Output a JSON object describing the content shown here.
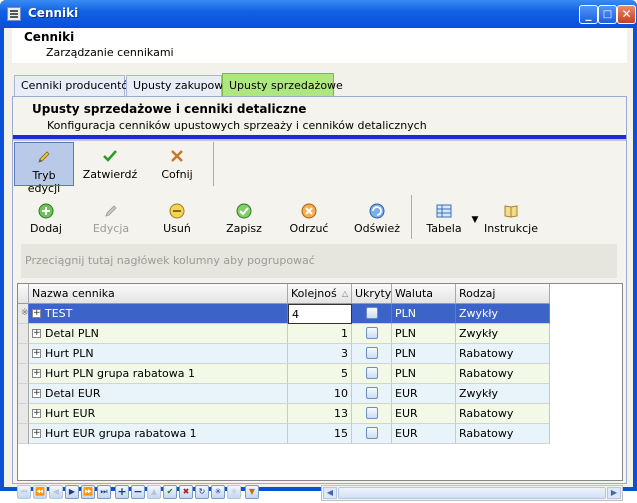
{
  "window": {
    "title": "Cenniki"
  },
  "header": {
    "title": "Cenniki",
    "subtitle": "Zarządzanie cennikami"
  },
  "tabs": [
    {
      "label": "Cenniki producentów"
    },
    {
      "label": "Upusty zakupowe"
    },
    {
      "label": "Upusty sprzedażowe"
    }
  ],
  "section": {
    "title": "Upusty sprzedażowe i cenniki detaliczne",
    "description": "Konfiguracja cenników upustowych sprzeaży i cenników detalicznych"
  },
  "toolbar1": {
    "edit_mode": "Tryb edycji",
    "confirm": "Zatwierdź",
    "undo": "Cofnij"
  },
  "toolbar2": {
    "add": "Dodaj",
    "edit": "Edycja",
    "delete": "Usuń",
    "save": "Zapisz",
    "discard": "Odrzuć",
    "refresh": "Odśwież",
    "table": "Tabela",
    "instructions": "Instrukcje"
  },
  "grid": {
    "group_hint": "Przeciągnij tutaj nagłówek kolumny aby pogrupować",
    "columns": [
      "Nazwa cennika",
      "Kolejnoś",
      "Ukryty",
      "Waluta",
      "Rodzaj"
    ],
    "rows": [
      {
        "name": "TEST",
        "order": "4",
        "currency": "PLN",
        "type": "Zwykły"
      },
      {
        "name": "Detal PLN",
        "order": "1",
        "currency": "PLN",
        "type": "Zwykły"
      },
      {
        "name": "Hurt PLN",
        "order": "3",
        "currency": "PLN",
        "type": "Rabatowy"
      },
      {
        "name": "Hurt PLN grupa rabatowa 1",
        "order": "5",
        "currency": "PLN",
        "type": "Rabatowy"
      },
      {
        "name": "Detal EUR",
        "order": "10",
        "currency": "EUR",
        "type": "Zwykły"
      },
      {
        "name": "Hurt EUR",
        "order": "13",
        "currency": "EUR",
        "type": "Rabatowy"
      },
      {
        "name": "Hurt EUR grupa rabatowa 1",
        "order": "15",
        "currency": "EUR",
        "type": "Rabatowy"
      }
    ],
    "new_row_marker": "※"
  },
  "colors": {
    "titlebar": "#0a50d8",
    "active_tab": "#aee77f",
    "selected_row": "#3c63c8",
    "accent_bar": "#1c2ad8"
  }
}
